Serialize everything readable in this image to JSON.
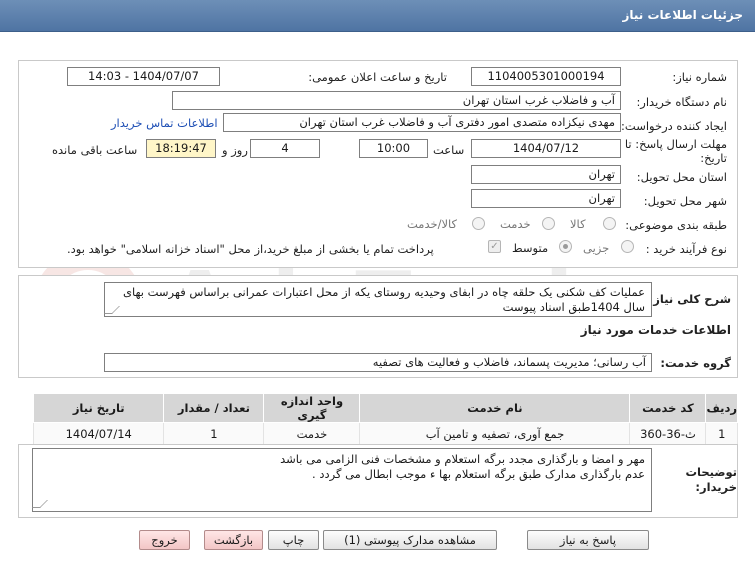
{
  "header": {
    "title": "جزئیات اطلاعات نیاز"
  },
  "watermark": {
    "text": "AriaTender.net"
  },
  "form": {
    "need_number_label": "شماره نیاز:",
    "need_number_value": "1104005301000194",
    "announce_label": "تاریخ و ساعت اعلان عمومی:",
    "announce_value": "1404/07/07 - 14:03",
    "buyer_org_label": "نام دستگاه خریدار:",
    "buyer_org_value": "آب و فاضلاب غرب استان تهران",
    "creator_label": "ایجاد کننده درخواست:",
    "creator_value": "مهدی نیکزاده متصدی امور دفتری آب و فاضلاب غرب استان تهران",
    "contact_link": "اطلاعات تماس خریدار",
    "deadline_label": "مهلت ارسال پاسخ: تا تاریخ:",
    "deadline_date": "1404/07/12",
    "time_label": "ساعت",
    "deadline_time": "10:00",
    "days_value": "4",
    "days_label": "روز و",
    "remaining_time": "18:19:47",
    "remaining_label": "ساعت باقی مانده",
    "province_label": "استان محل تحویل:",
    "province_value": "تهران",
    "city_label": "شهر محل تحویل:",
    "city_value": "تهران",
    "category_label": "طبقه بندی موضوعی:",
    "category_options": [
      "کالا",
      "خدمت",
      "کالا/خدمت"
    ],
    "category_selected": 1,
    "process_label": "نوع فرآیند خرید :",
    "process_options": [
      "جزیی",
      "متوسط"
    ],
    "process_selected": 1,
    "payment_note": "پرداخت تمام یا بخشی از مبلغ خرید،از محل \"اسناد خزانه اسلامی\" خواهد بود."
  },
  "summary": {
    "label": "شرح کلی نیاز:",
    "text": "عملیات کف شکنی یک حلقه چاه در ابفای وحیدیه روستای یکه از محل اعتبارات عمرانی براساس فهرست بهای سال 1404طبق اسناد پیوست"
  },
  "services": {
    "title": "اطلاعات خدمات مورد نیاز",
    "group_label": "گروه خدمت:",
    "group_value": "آب رسانی؛ مدیریت پسماند، فاضلاب و فعالیت های تصفیه",
    "columns": [
      "ردیف",
      "کد خدمت",
      "نام خدمت",
      "واحد اندازه گیری",
      "تعداد / مقدار",
      "تاریخ نیاز"
    ],
    "rows": [
      [
        "1",
        "ث-36-360",
        "جمع آوری، تصفیه و تامین آب",
        "خدمت",
        "1",
        "1404/07/14"
      ]
    ]
  },
  "buyer_notes": {
    "label": "توضیحات خریدار:",
    "line1": "مهر و امضا و بارگذاری مجدد برگه استعلام و  مشخصات فنی الزامی می باشد",
    "line2": "عدم بارگذاری مدارک طبق برگه استعلام بها ء موجب ابطال می گردد ."
  },
  "buttons": {
    "reply": "پاسخ به نیاز",
    "attachments": "مشاهده مدارک پیوستی (1)",
    "print": "چاپ",
    "back": "بازگشت",
    "exit": "خروج"
  }
}
